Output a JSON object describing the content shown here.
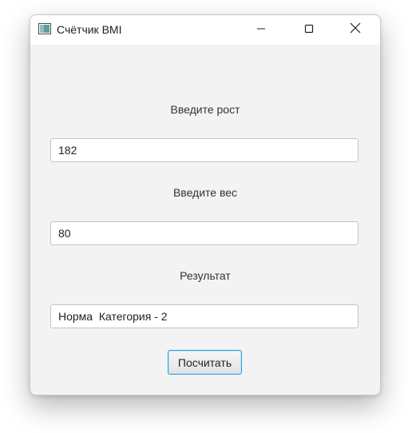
{
  "window": {
    "title": "Счётчик BMI",
    "icon": "app-window-icon",
    "controls": [
      "minimize-icon",
      "maximize-icon",
      "close-icon"
    ]
  },
  "form": {
    "height_label": "Введите рост",
    "height_value": "182",
    "weight_label": "Введите вес",
    "weight_value": "80",
    "result_label": "Результат",
    "result_value": "Норма  Категория - 2",
    "calculate_button": "Посчитать"
  },
  "colors": {
    "window_bg": "#f3f3f3",
    "titlebar_bg": "#ffffff",
    "focus_accent": "#2a9fd8"
  }
}
